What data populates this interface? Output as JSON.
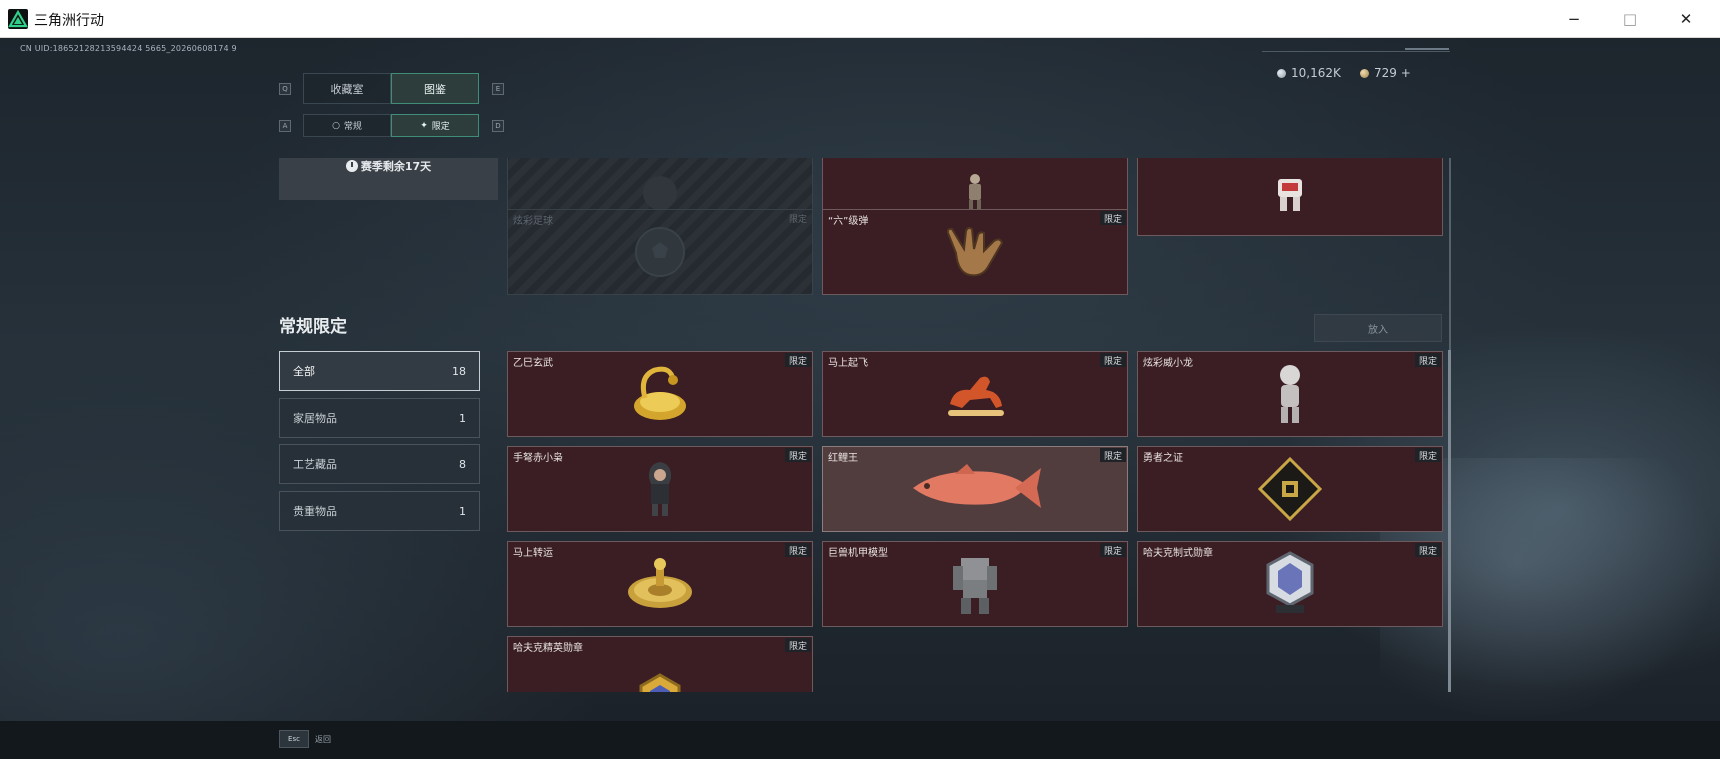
{
  "window": {
    "title": "三角洲行动",
    "minimize": "−",
    "maximize": "□",
    "close": "✕"
  },
  "header": {
    "uid": "CN UID:18652128213594424 5665_20260608174 9",
    "currency_1": "10,162K",
    "currency_2": "729 +"
  },
  "tabs": {
    "main": [
      {
        "label": "收藏室",
        "active": false
      },
      {
        "label": "图鉴",
        "active": true
      }
    ],
    "main_left_key": "Q",
    "main_right_key": "E",
    "sub": [
      {
        "label": "常规",
        "icon": "ring-icon",
        "active": false
      },
      {
        "label": "限定",
        "icon": "sparkle-icon",
        "active": true
      }
    ],
    "sub_left_key": "A",
    "sub_right_key": "D"
  },
  "season": {
    "remaining": "赛季剩余17天"
  },
  "section": {
    "title": "常规限定"
  },
  "filters": [
    {
      "label": "全部",
      "count": "18",
      "active": true
    },
    {
      "label": "家居物品",
      "count": "1",
      "active": false
    },
    {
      "label": "工艺藏品",
      "count": "8",
      "active": false
    },
    {
      "label": "贵重物品",
      "count": "1",
      "active": false
    }
  ],
  "put_in_button": "放入",
  "top_cards": [
    {
      "name": "",
      "tag": "",
      "locked": true,
      "icon": "ball-silhouette-icon"
    },
    {
      "name": "",
      "tag": "",
      "locked": false,
      "icon": "figurine-icon"
    },
    {
      "name": "",
      "tag": "",
      "locked": false,
      "icon": "mech-figure-icon"
    },
    {
      "name": "炫彩足球",
      "tag": "限定",
      "locked": true,
      "icon": "soccer-ball-icon"
    },
    {
      "name": "“六”级弹",
      "tag": "限定",
      "locked": false,
      "icon": "shaka-hand-icon"
    }
  ],
  "items": [
    {
      "name": "乙巳玄武",
      "tag": "限定",
      "icon": "golden-tortoise-snake-icon"
    },
    {
      "name": "马上起飞",
      "tag": "限定",
      "icon": "red-horse-icon"
    },
    {
      "name": "炫彩威小龙",
      "tag": "限定",
      "icon": "silver-dragon-figure-icon"
    },
    {
      "name": "手弩赤小枭",
      "tag": "限定",
      "icon": "hooded-figure-icon"
    },
    {
      "name": "红鲤王",
      "tag": "限定",
      "icon": "red-carp-icon",
      "highlight": true
    },
    {
      "name": "勇者之证",
      "tag": "限定",
      "icon": "gold-card-icon"
    },
    {
      "name": "马上转运",
      "tag": "限定",
      "icon": "golden-wheel-icon"
    },
    {
      "name": "巨兽机甲模型",
      "tag": "限定",
      "icon": "mech-model-icon"
    },
    {
      "name": "哈夫克制式勋章",
      "tag": "限定",
      "icon": "silver-medal-icon"
    },
    {
      "name": "哈夫克精英勋章",
      "tag": "限定",
      "icon": "gold-medal-icon"
    }
  ],
  "footer": {
    "key": "Esc",
    "label": "返回"
  }
}
